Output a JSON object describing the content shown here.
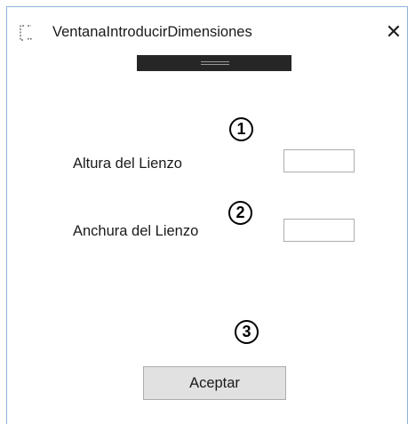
{
  "window": {
    "title": "VentanaIntroducirDimensiones",
    "close_glyph": "✕",
    "app_icon": "window-app-icon"
  },
  "form": {
    "altura_label": "Altura del Lienzo",
    "altura_value": "",
    "anchura_label": "Anchura del Lienzo",
    "anchura_value": "",
    "accept_label": "Aceptar"
  },
  "annotations": [
    "1",
    "2",
    "3"
  ],
  "colors": {
    "window_border": "#8fb3d9",
    "drag_bar": "#262626",
    "button_bg": "#e1e1e1",
    "button_border": "#adadad"
  }
}
